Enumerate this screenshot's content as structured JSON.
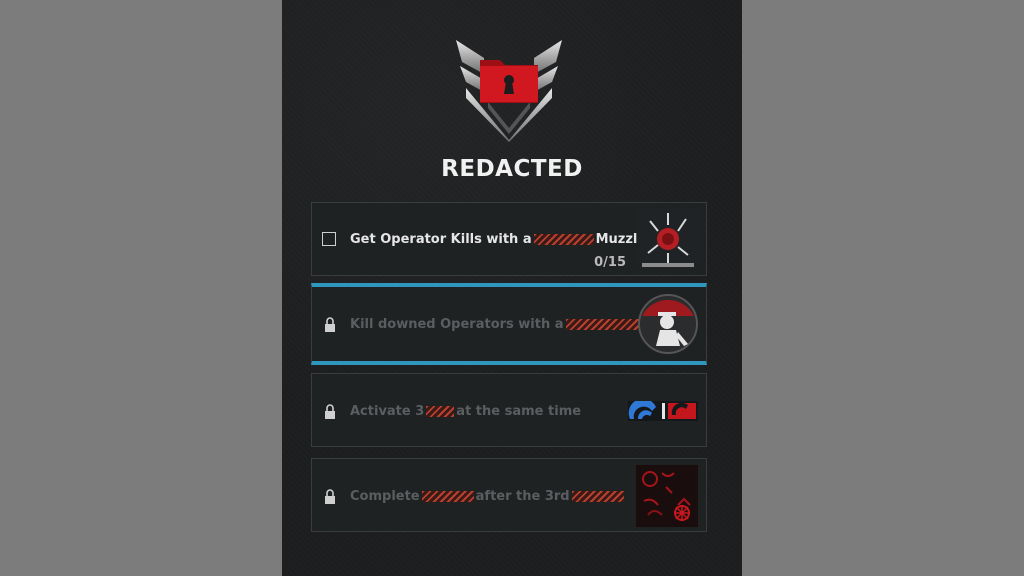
{
  "header": {
    "title": "REDACTED"
  },
  "missions": [
    {
      "text_before": "Get Operator Kills with a",
      "text_after": "Muzzle",
      "progress": "0/15",
      "state": "current"
    },
    {
      "text_before": "Kill downed Operators with a",
      "text_after": "",
      "state": "locked"
    },
    {
      "text_before": "Activate 3",
      "text_after": "at the same time",
      "state": "locked"
    },
    {
      "text_before": "Complete",
      "text_middle": "after the 3rd",
      "text_after": "",
      "state": "locked"
    }
  ],
  "colors": {
    "accent": "#2f96bd",
    "redact": "#b8402f",
    "folder": "#c8141c"
  },
  "icons": [
    "emblem-chevron-icon",
    "folder-lock-icon",
    "checkbox-icon",
    "lock-icon"
  ]
}
